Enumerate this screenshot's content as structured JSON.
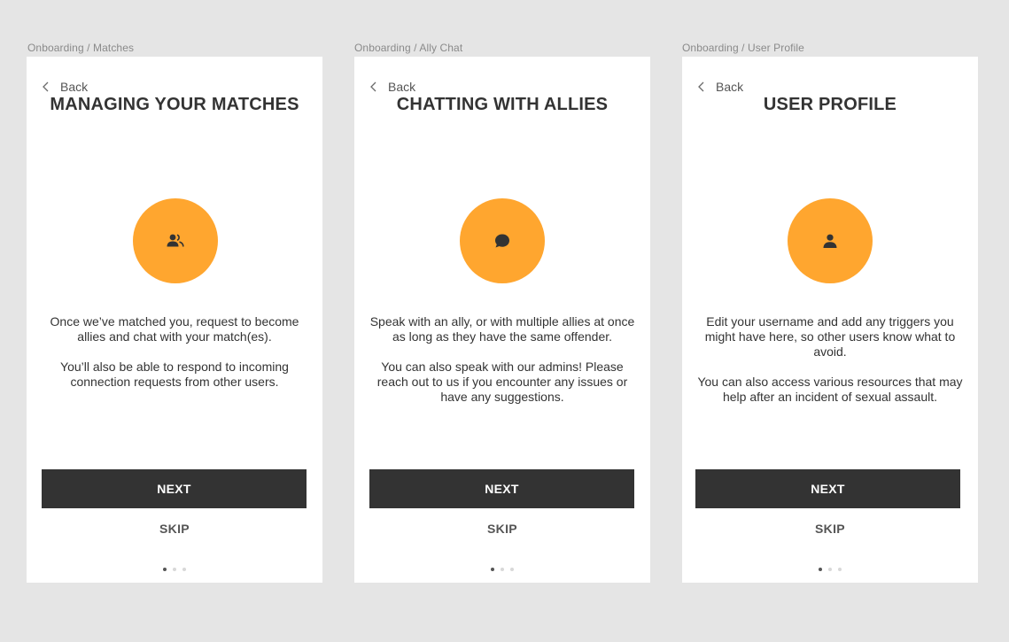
{
  "colors": {
    "canvas_background": "#e5e5e5",
    "card_background": "#ffffff",
    "accent_orange": "#ffa62f",
    "button_dark": "#333333",
    "text_dark": "#333333",
    "text_muted": "#555555",
    "dot_inactive": "#d8d8d8",
    "dot_active": "#555555"
  },
  "screens": [
    {
      "frame_label": "Onboarding / Matches",
      "back_label": "Back",
      "back_icon": "chevron-left-icon",
      "title": "MANAGING YOUR MATCHES",
      "icon": "users-icon",
      "paragraphs": [
        "Once we’ve matched you, request to become allies and chat with your match(es).",
        "You’ll also be able to respond to incoming connection requests from other users."
      ],
      "next_label": "NEXT",
      "skip_label": "SKIP",
      "pagination": {
        "total": 3,
        "active": 1
      }
    },
    {
      "frame_label": "Onboarding / Ally Chat",
      "back_label": "Back",
      "back_icon": "chevron-left-icon",
      "title": "CHATTING WITH ALLIES",
      "icon": "chat-bubble-icon",
      "paragraphs": [
        "Speak with an ally, or with multiple allies at once as long as they have the same offender.",
        "You can also speak with our admins! Please reach out to us if you encounter any issues or have any suggestions."
      ],
      "next_label": "NEXT",
      "skip_label": "SKIP",
      "pagination": {
        "total": 3,
        "active": 1
      }
    },
    {
      "frame_label": "Onboarding / User Profile",
      "back_label": "Back",
      "back_icon": "chevron-left-icon",
      "title": "USER PROFILE",
      "icon": "user-icon",
      "paragraphs": [
        "Edit your username and add any triggers you might have here, so other users know what to avoid.",
        "You can also access various resources that may help after an incident of sexual assault."
      ],
      "next_label": "NEXT",
      "skip_label": "SKIP",
      "pagination": {
        "total": 3,
        "active": 1
      }
    }
  ]
}
